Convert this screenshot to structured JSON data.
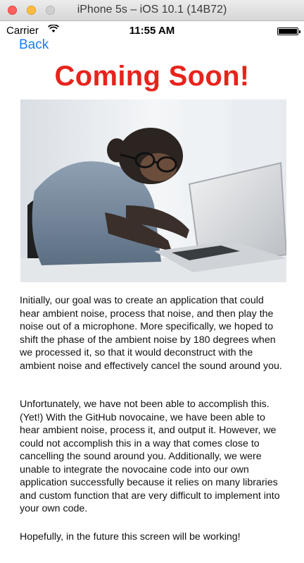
{
  "window": {
    "title": "iPhone 5s – iOS 10.1 (14B72)"
  },
  "status_bar": {
    "carrier": "Carrier",
    "time": "11:55 AM"
  },
  "nav": {
    "back_label": "Back"
  },
  "heading": "Coming Soon!",
  "paragraphs": [
    "Initially, our goal was to create an application that could hear ambient noise, process that noise, and then play the noise out of a microphone. More specifically, we hoped to shift the phase of the ambient noise by 180 degrees when we processed it, so that it would deconstruct with the ambient noise and effectively cancel the sound around you.",
    "Unfortunately, we have not been able to accomplish this. (Yet!) With the GitHub novocaine, we have been able to hear ambient noise, process it, and output it. However, we could not accomplish this in a way that comes close to cancelling the sound around you. Additionally, we were unable to integrate the novocaine code into our own application successfully because it relies on many libraries and custom function that are very difficult to implement into your own code.",
    "Hopefully, in the future this screen will be working!"
  ],
  "icons": {
    "wifi": "wifi-icon",
    "battery": "battery-icon"
  },
  "colors": {
    "heading": "#e8231c",
    "link": "#1a7cf7"
  }
}
